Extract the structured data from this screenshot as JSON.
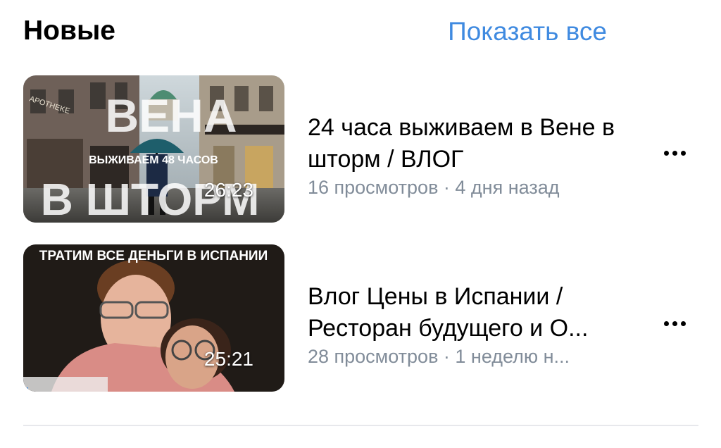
{
  "section": {
    "title": "Новые",
    "show_all_label": "Показать все"
  },
  "videos": [
    {
      "title": "24 часа выживаем в Вене в шторм / ВЛОГ",
      "meta": "16 просмотров · 4 дня назад",
      "duration": "26:23",
      "thumbnail_text": {
        "top": "ВЕНА",
        "middle": "ВЫЖИВАЕМ 48 ЧАСОВ",
        "bottom": "В ШТОРМ",
        "sign": "APOTHEKE"
      },
      "watch_progress": 0
    },
    {
      "title": "Влог Цены в Испании / Ресторан будущего и О...",
      "meta": "28 просмотров · 1 неделю н...",
      "duration": "25:21",
      "thumbnail_text": {
        "top": "ТРАТИМ ВСЕ ДЕНЬГИ В ИСПАНИИ"
      },
      "watch_progress": 0.02
    }
  ],
  "colors": {
    "accent": "#3f8ae0",
    "secondary_text": "#818c99",
    "divider": "#e7e8ec"
  },
  "icons": {
    "more": "more-horizontal-icon"
  }
}
